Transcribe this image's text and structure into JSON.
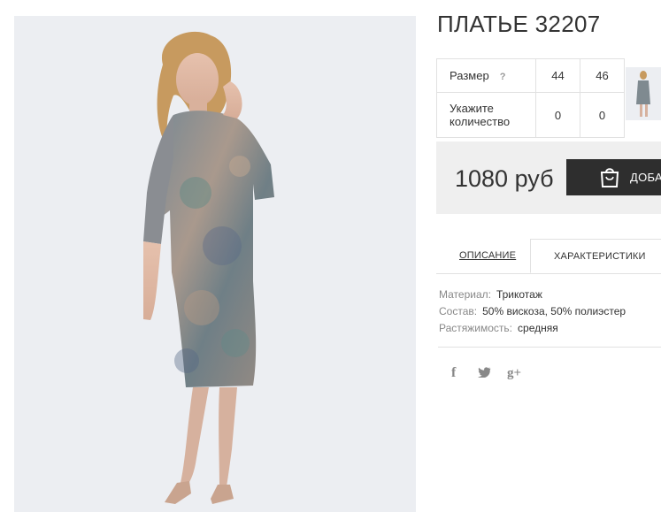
{
  "product": {
    "title": "ПЛАТЬЕ 32207",
    "price": "1080 руб",
    "buy_button_label": "ДОБАВ"
  },
  "sizes": {
    "size_label": "Размер",
    "help_symbol": "?",
    "qty_label": "Укажите количество",
    "columns": [
      {
        "size": "44",
        "qty": "0"
      },
      {
        "size": "46",
        "qty": "0"
      }
    ]
  },
  "tabs": {
    "description": "ОПИСАНИЕ",
    "characteristics": "ХАРАКТЕРИСТИКИ",
    "active": "characteristics"
  },
  "specs": [
    {
      "key": "Материал:",
      "value": "Трикотаж"
    },
    {
      "key": "Состав:",
      "value": "50% вискоза, 50% полиэстер"
    },
    {
      "key": "Растяжимость:",
      "value": "средняя"
    }
  ],
  "social": {
    "facebook": "f",
    "twitter": "🐦",
    "googleplus": "g+"
  },
  "icons": {
    "help": "question-icon",
    "bag": "shopping-bag-icon",
    "facebook": "facebook-icon",
    "twitter": "twitter-icon",
    "googleplus": "google-plus-icon"
  },
  "colors": {
    "button_bg": "#2e2e2e",
    "buybox_bg": "#efefef",
    "border": "#e1e1e1",
    "photo_bg": "#eceef2"
  }
}
